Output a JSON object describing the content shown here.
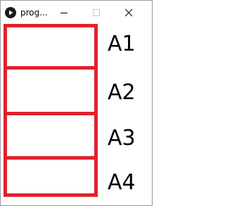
{
  "window": {
    "title": "prog..."
  },
  "controls": {
    "minimize_icon": "minimize-icon",
    "maximize_icon": "maximize-icon",
    "close_icon": "close-icon"
  },
  "colors": {
    "frame_border": "#e1222d",
    "title_text": "#000000"
  },
  "frames": [
    {
      "label": "A1"
    },
    {
      "label": "A2"
    },
    {
      "label": "A3"
    },
    {
      "label": "A4"
    }
  ]
}
